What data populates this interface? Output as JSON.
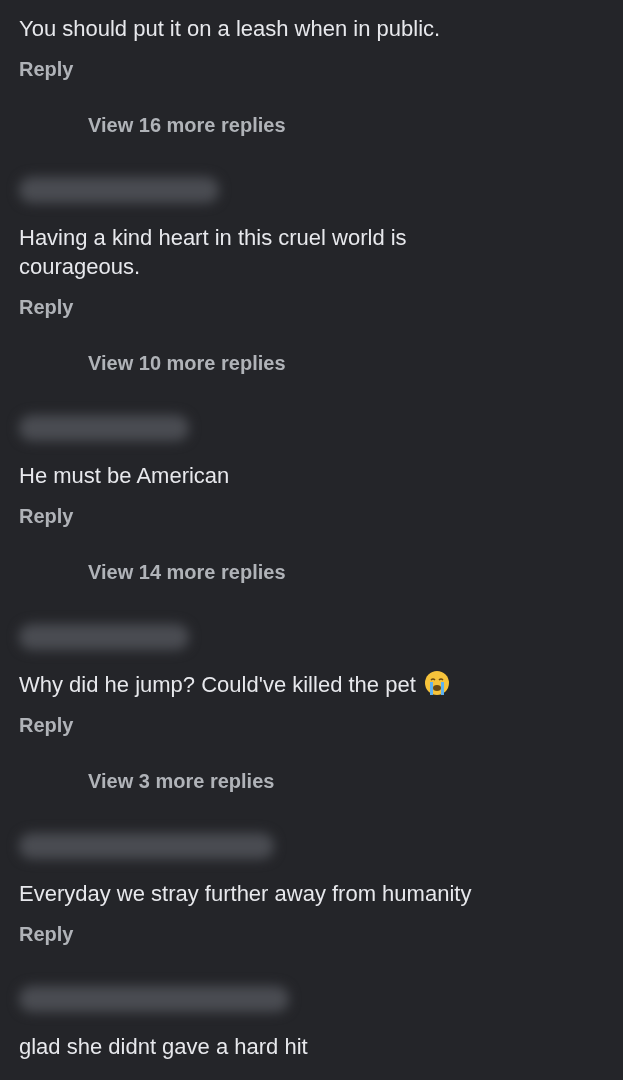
{
  "comments": [
    {
      "name_blurred": false,
      "text": "You should put it on a leash when in public.",
      "crying_emoji": false,
      "reply": "Reply",
      "view_more": "View 16 more replies"
    },
    {
      "name_blurred": true,
      "text": "Having a kind heart in this cruel world is courageous.",
      "crying_emoji": false,
      "reply": "Reply",
      "view_more": "View 10 more replies"
    },
    {
      "name_blurred": true,
      "text": "He must be American",
      "crying_emoji": false,
      "reply": "Reply",
      "view_more": "View 14 more replies"
    },
    {
      "name_blurred": true,
      "text": "Why did he jump? Could've killed the pet",
      "crying_emoji": true,
      "reply": "Reply",
      "view_more": "View 3 more replies"
    },
    {
      "name_blurred": true,
      "text": "Everyday we stray further away from humanity",
      "crying_emoji": false,
      "reply": "Reply"
    },
    {
      "name_blurred": true,
      "text": "glad she didnt gave a hard hit",
      "crying_emoji": false
    }
  ]
}
